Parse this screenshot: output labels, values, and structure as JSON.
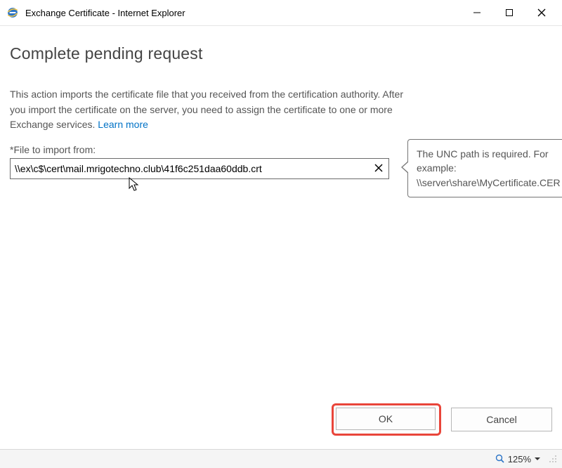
{
  "window": {
    "title": "Exchange Certificate - Internet Explorer"
  },
  "page": {
    "heading": "Complete pending request",
    "instruction_text": "This action imports the certificate file that you received from the certification authority. After you import the certificate on the server, you need to assign the certificate to one or more Exchange services. ",
    "learn_more_label": "Learn more"
  },
  "form": {
    "file_label": "*File to import from:",
    "file_value": "\\\\ex\\c$\\cert\\mail.mrigotechno.club\\41f6c251daa60ddb.crt"
  },
  "tooltip": {
    "text": "The UNC path is required. For example: \\\\server\\share\\MyCertificate.CER"
  },
  "buttons": {
    "ok": "OK",
    "cancel": "Cancel"
  },
  "status": {
    "zoom": "125%"
  }
}
